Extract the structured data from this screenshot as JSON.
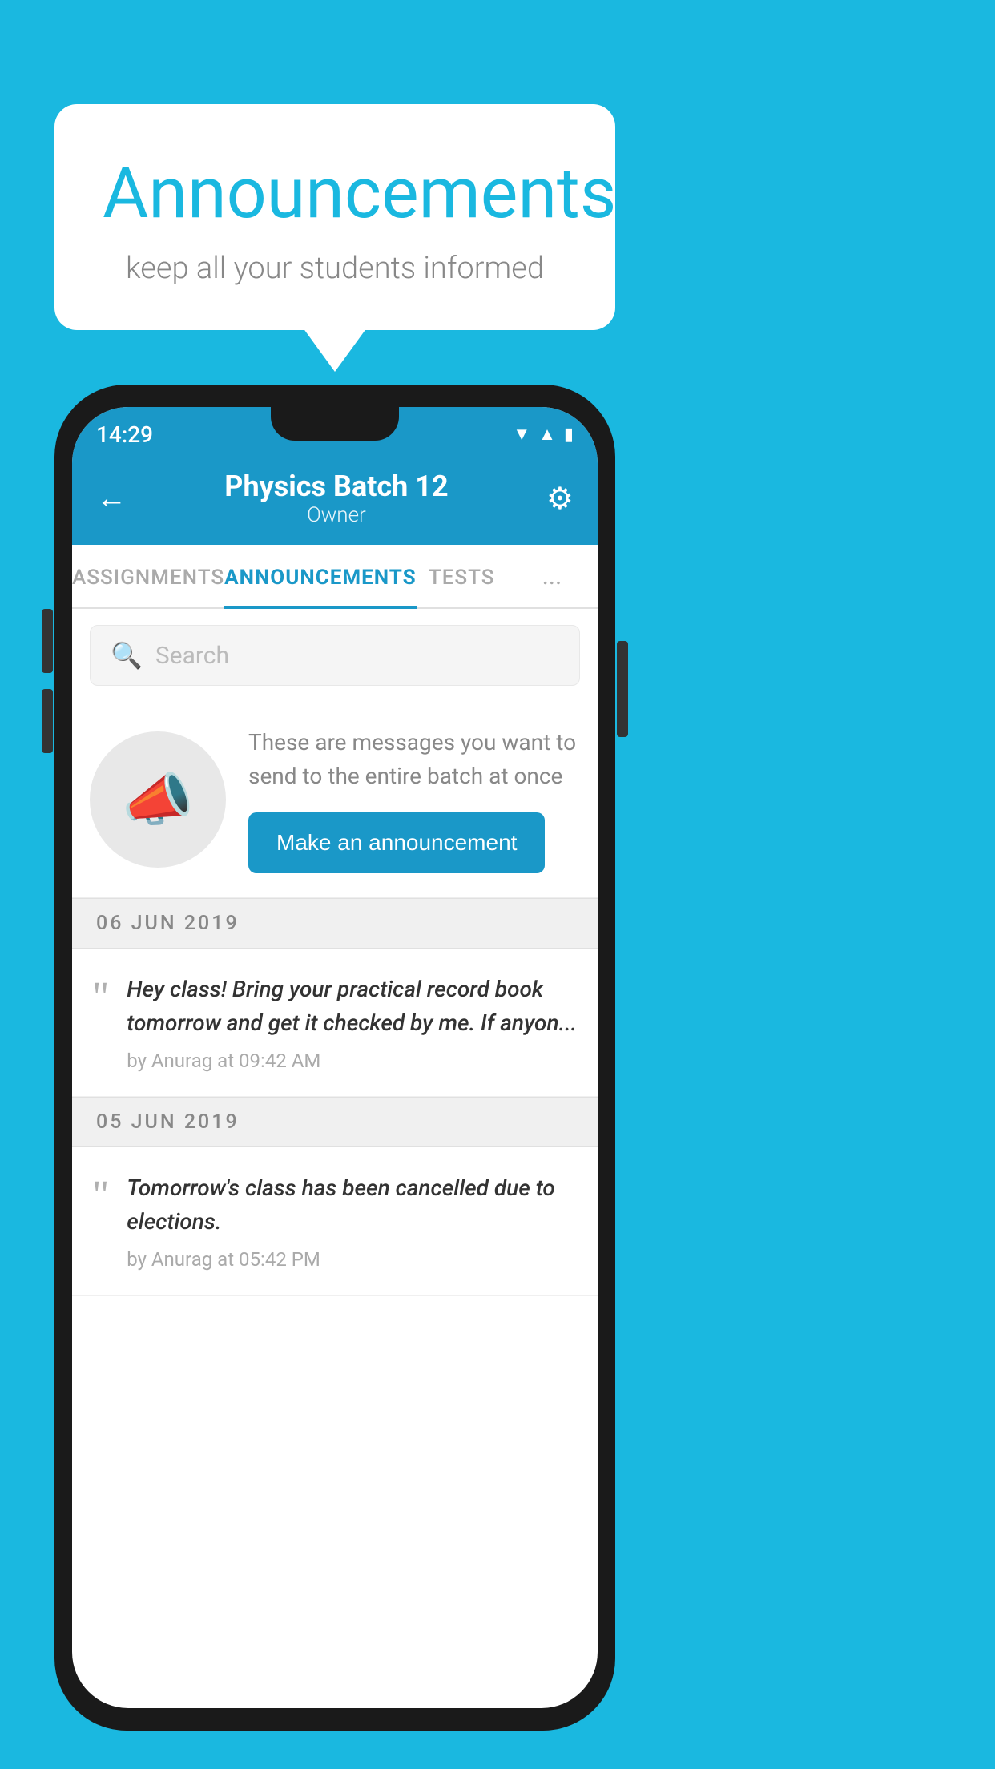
{
  "announcement_card": {
    "title": "Announcements",
    "subtitle": "keep all your students informed"
  },
  "status_bar": {
    "time": "14:29",
    "icons": [
      "wifi",
      "signal",
      "battery"
    ]
  },
  "app_header": {
    "title": "Physics Batch 12",
    "subtitle": "Owner",
    "back_label": "←",
    "gear_label": "⚙"
  },
  "tabs": [
    {
      "label": "ASSIGNMENTS",
      "active": false
    },
    {
      "label": "ANNOUNCEMENTS",
      "active": true
    },
    {
      "label": "TESTS",
      "active": false
    },
    {
      "label": "...",
      "active": false
    }
  ],
  "search": {
    "placeholder": "Search"
  },
  "intro": {
    "text": "These are messages you want to send to the entire batch at once",
    "button_label": "Make an announcement"
  },
  "announcements": [
    {
      "date": "06  JUN  2019",
      "text": "Hey class! Bring your practical record book tomorrow and get it checked by me. If anyon...",
      "meta": "by Anurag at 09:42 AM"
    },
    {
      "date": "05  JUN  2019",
      "text": "Tomorrow's class has been cancelled due to elections.",
      "meta": "by Anurag at 05:42 PM"
    }
  ],
  "colors": {
    "primary": "#1a98c8",
    "background": "#1ab8e0",
    "white": "#ffffff"
  }
}
